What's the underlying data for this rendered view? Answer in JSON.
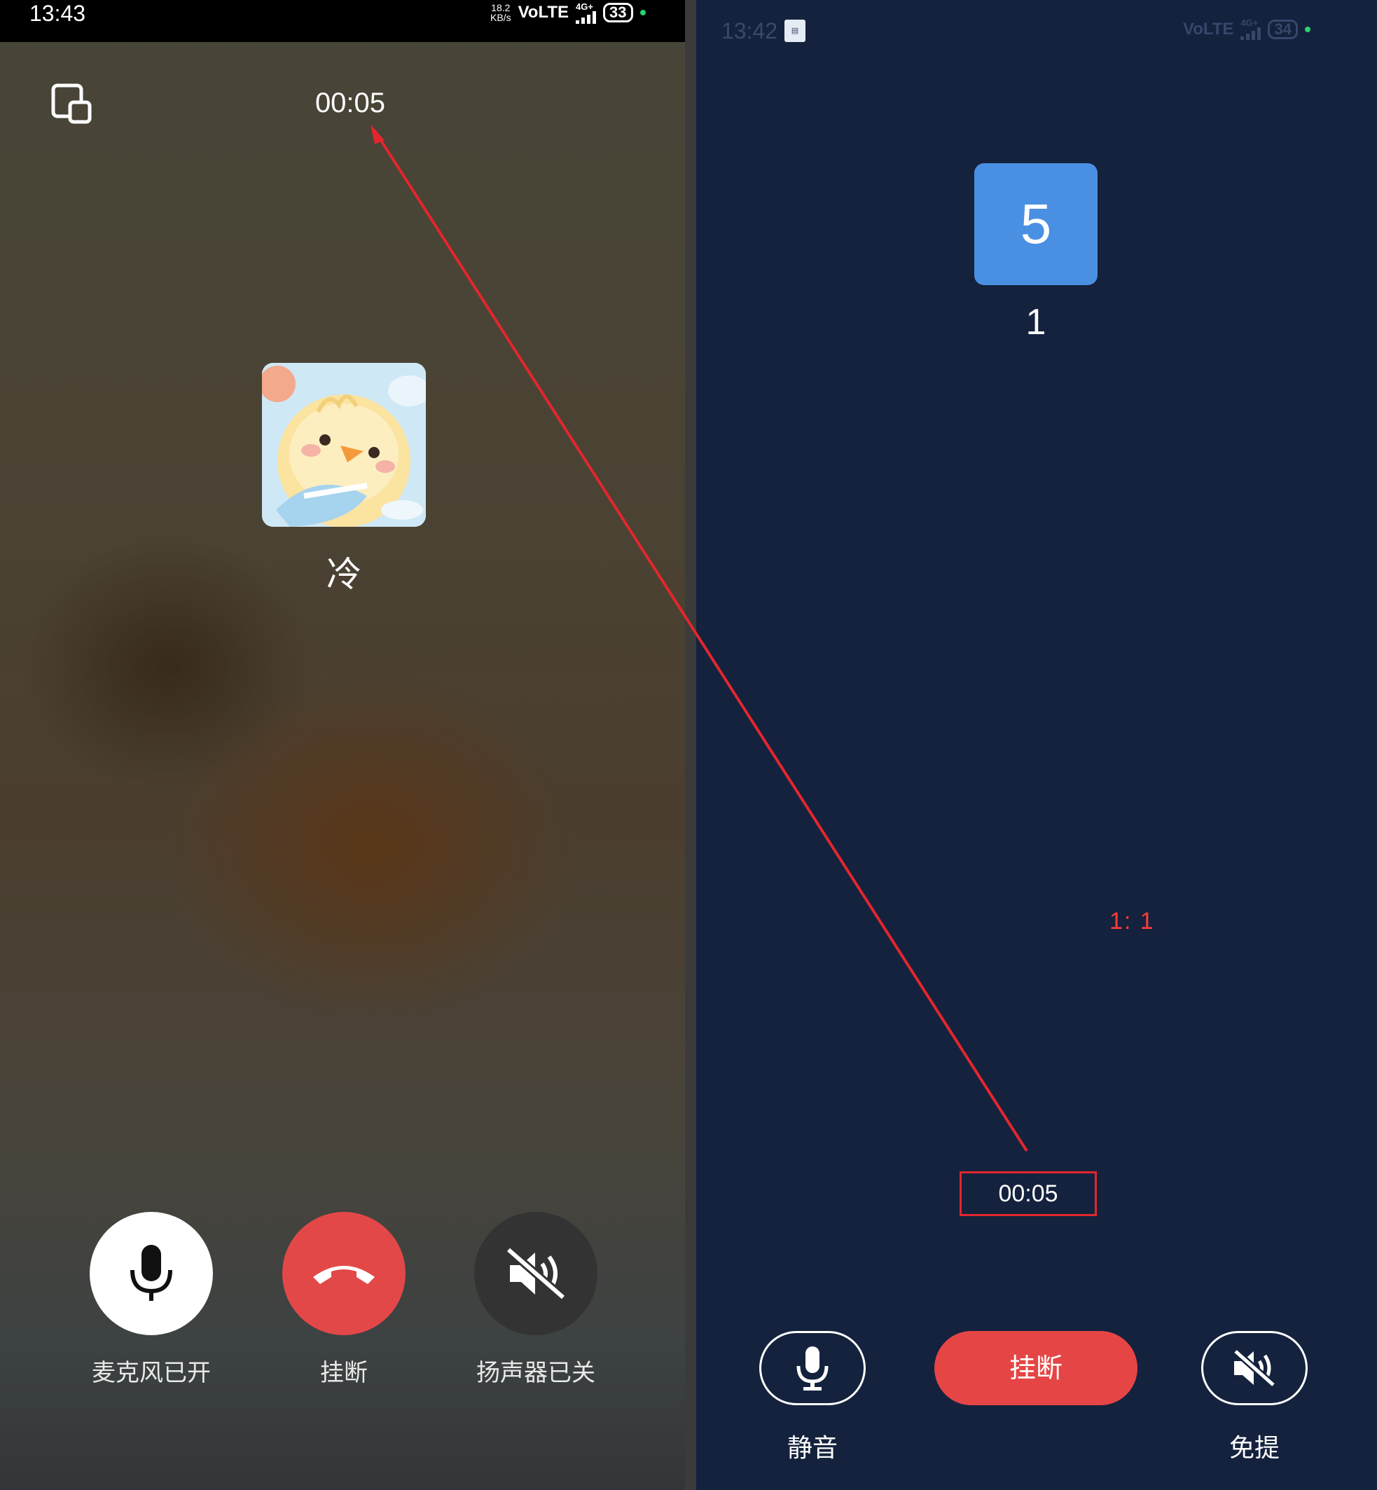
{
  "left_screen": {
    "status": {
      "time": "13:43",
      "speed_value": "18.2",
      "speed_unit": "KB/s",
      "network": "VoLTE",
      "signal_type": "4G+",
      "battery": "33"
    },
    "timer": "00:05",
    "contact_name": "冷",
    "avatar": "chick-avatar-image",
    "minimize_icon": "floating-window-icon",
    "buttons": {
      "mic_label": "麦克风已开",
      "hangup_label": "挂断",
      "speaker_label": "扬声器已关"
    }
  },
  "right_screen": {
    "status": {
      "time": "13:42",
      "network": "VoLTE",
      "signal_type": "4G+",
      "battery": "34"
    },
    "badge_text": "5",
    "number": "1",
    "ratio_annotation": "1: 1",
    "timer": "00:05",
    "buttons": {
      "hangup_label": "挂断",
      "mute_label": "静音",
      "speaker_label": "免提"
    }
  },
  "annotation": {
    "color": "#e3262d",
    "arrow": "arrow from right timer to left timer"
  },
  "colors": {
    "hangup_red": "#e64545",
    "right_bg": "#14223d",
    "badge_blue": "#4a90e2"
  }
}
